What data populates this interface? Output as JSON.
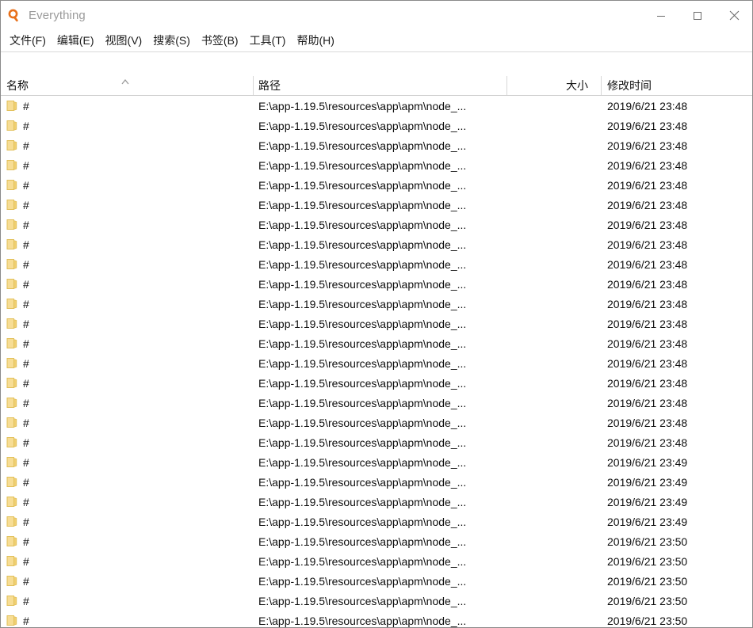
{
  "window": {
    "title": "Everything",
    "app_icon": "magnifier-icon",
    "controls": {
      "minimize": "minimize-icon",
      "maximize": "maximize-icon",
      "close": "close-icon"
    }
  },
  "menubar": {
    "items": [
      {
        "label": "文件(F)"
      },
      {
        "label": "编辑(E)"
      },
      {
        "label": "视图(V)"
      },
      {
        "label": "搜索(S)"
      },
      {
        "label": "书签(B)"
      },
      {
        "label": "工具(T)"
      },
      {
        "label": "帮助(H)"
      }
    ]
  },
  "table": {
    "columns": [
      {
        "label": "名称",
        "key": "name",
        "sort": "ascending",
        "sort_icon": "chevron-up-icon"
      },
      {
        "label": "路径",
        "key": "path"
      },
      {
        "label": "大小",
        "key": "size"
      },
      {
        "label": "修改时间",
        "key": "date"
      }
    ],
    "rows": [
      {
        "icon": "folder-icon",
        "name": "#",
        "path": "E:\\app-1.19.5\\resources\\app\\apm\\node_...",
        "size": "",
        "date": "2019/6/21 23:48"
      },
      {
        "icon": "folder-icon",
        "name": "#",
        "path": "E:\\app-1.19.5\\resources\\app\\apm\\node_...",
        "size": "",
        "date": "2019/6/21 23:48"
      },
      {
        "icon": "folder-icon",
        "name": "#",
        "path": "E:\\app-1.19.5\\resources\\app\\apm\\node_...",
        "size": "",
        "date": "2019/6/21 23:48"
      },
      {
        "icon": "folder-icon",
        "name": "#",
        "path": "E:\\app-1.19.5\\resources\\app\\apm\\node_...",
        "size": "",
        "date": "2019/6/21 23:48"
      },
      {
        "icon": "folder-icon",
        "name": "#",
        "path": "E:\\app-1.19.5\\resources\\app\\apm\\node_...",
        "size": "",
        "date": "2019/6/21 23:48"
      },
      {
        "icon": "folder-icon",
        "name": "#",
        "path": "E:\\app-1.19.5\\resources\\app\\apm\\node_...",
        "size": "",
        "date": "2019/6/21 23:48"
      },
      {
        "icon": "folder-icon",
        "name": "#",
        "path": "E:\\app-1.19.5\\resources\\app\\apm\\node_...",
        "size": "",
        "date": "2019/6/21 23:48"
      },
      {
        "icon": "folder-icon",
        "name": "#",
        "path": "E:\\app-1.19.5\\resources\\app\\apm\\node_...",
        "size": "",
        "date": "2019/6/21 23:48"
      },
      {
        "icon": "folder-icon",
        "name": "#",
        "path": "E:\\app-1.19.5\\resources\\app\\apm\\node_...",
        "size": "",
        "date": "2019/6/21 23:48"
      },
      {
        "icon": "folder-icon",
        "name": "#",
        "path": "E:\\app-1.19.5\\resources\\app\\apm\\node_...",
        "size": "",
        "date": "2019/6/21 23:48"
      },
      {
        "icon": "folder-icon",
        "name": "#",
        "path": "E:\\app-1.19.5\\resources\\app\\apm\\node_...",
        "size": "",
        "date": "2019/6/21 23:48"
      },
      {
        "icon": "folder-icon",
        "name": "#",
        "path": "E:\\app-1.19.5\\resources\\app\\apm\\node_...",
        "size": "",
        "date": "2019/6/21 23:48"
      },
      {
        "icon": "folder-icon",
        "name": "#",
        "path": "E:\\app-1.19.5\\resources\\app\\apm\\node_...",
        "size": "",
        "date": "2019/6/21 23:48"
      },
      {
        "icon": "folder-icon",
        "name": "#",
        "path": "E:\\app-1.19.5\\resources\\app\\apm\\node_...",
        "size": "",
        "date": "2019/6/21 23:48"
      },
      {
        "icon": "folder-icon",
        "name": "#",
        "path": "E:\\app-1.19.5\\resources\\app\\apm\\node_...",
        "size": "",
        "date": "2019/6/21 23:48"
      },
      {
        "icon": "folder-icon",
        "name": "#",
        "path": "E:\\app-1.19.5\\resources\\app\\apm\\node_...",
        "size": "",
        "date": "2019/6/21 23:48"
      },
      {
        "icon": "folder-icon",
        "name": "#",
        "path": "E:\\app-1.19.5\\resources\\app\\apm\\node_...",
        "size": "",
        "date": "2019/6/21 23:48"
      },
      {
        "icon": "folder-icon",
        "name": "#",
        "path": "E:\\app-1.19.5\\resources\\app\\apm\\node_...",
        "size": "",
        "date": "2019/6/21 23:48"
      },
      {
        "icon": "folder-icon",
        "name": "#",
        "path": "E:\\app-1.19.5\\resources\\app\\apm\\node_...",
        "size": "",
        "date": "2019/6/21 23:49"
      },
      {
        "icon": "folder-icon",
        "name": "#",
        "path": "E:\\app-1.19.5\\resources\\app\\apm\\node_...",
        "size": "",
        "date": "2019/6/21 23:49"
      },
      {
        "icon": "folder-icon",
        "name": "#",
        "path": "E:\\app-1.19.5\\resources\\app\\apm\\node_...",
        "size": "",
        "date": "2019/6/21 23:49"
      },
      {
        "icon": "folder-icon",
        "name": "#",
        "path": "E:\\app-1.19.5\\resources\\app\\apm\\node_...",
        "size": "",
        "date": "2019/6/21 23:49"
      },
      {
        "icon": "folder-icon",
        "name": "#",
        "path": "E:\\app-1.19.5\\resources\\app\\apm\\node_...",
        "size": "",
        "date": "2019/6/21 23:50"
      },
      {
        "icon": "folder-icon",
        "name": "#",
        "path": "E:\\app-1.19.5\\resources\\app\\apm\\node_...",
        "size": "",
        "date": "2019/6/21 23:50"
      },
      {
        "icon": "folder-icon",
        "name": "#",
        "path": "E:\\app-1.19.5\\resources\\app\\apm\\node_...",
        "size": "",
        "date": "2019/6/21 23:50"
      },
      {
        "icon": "folder-icon",
        "name": "#",
        "path": "E:\\app-1.19.5\\resources\\app\\apm\\node_...",
        "size": "",
        "date": "2019/6/21 23:50"
      },
      {
        "icon": "folder-icon",
        "name": "#",
        "path": "E:\\app-1.19.5\\resources\\app\\apm\\node_...",
        "size": "",
        "date": "2019/6/21 23:50"
      }
    ]
  },
  "colors": {
    "accent": "#e8701a",
    "title_text": "#9a9a9a",
    "row_text": "#0d0d0d",
    "folder": "#f5d77e",
    "separator": "#d7d7d7"
  }
}
